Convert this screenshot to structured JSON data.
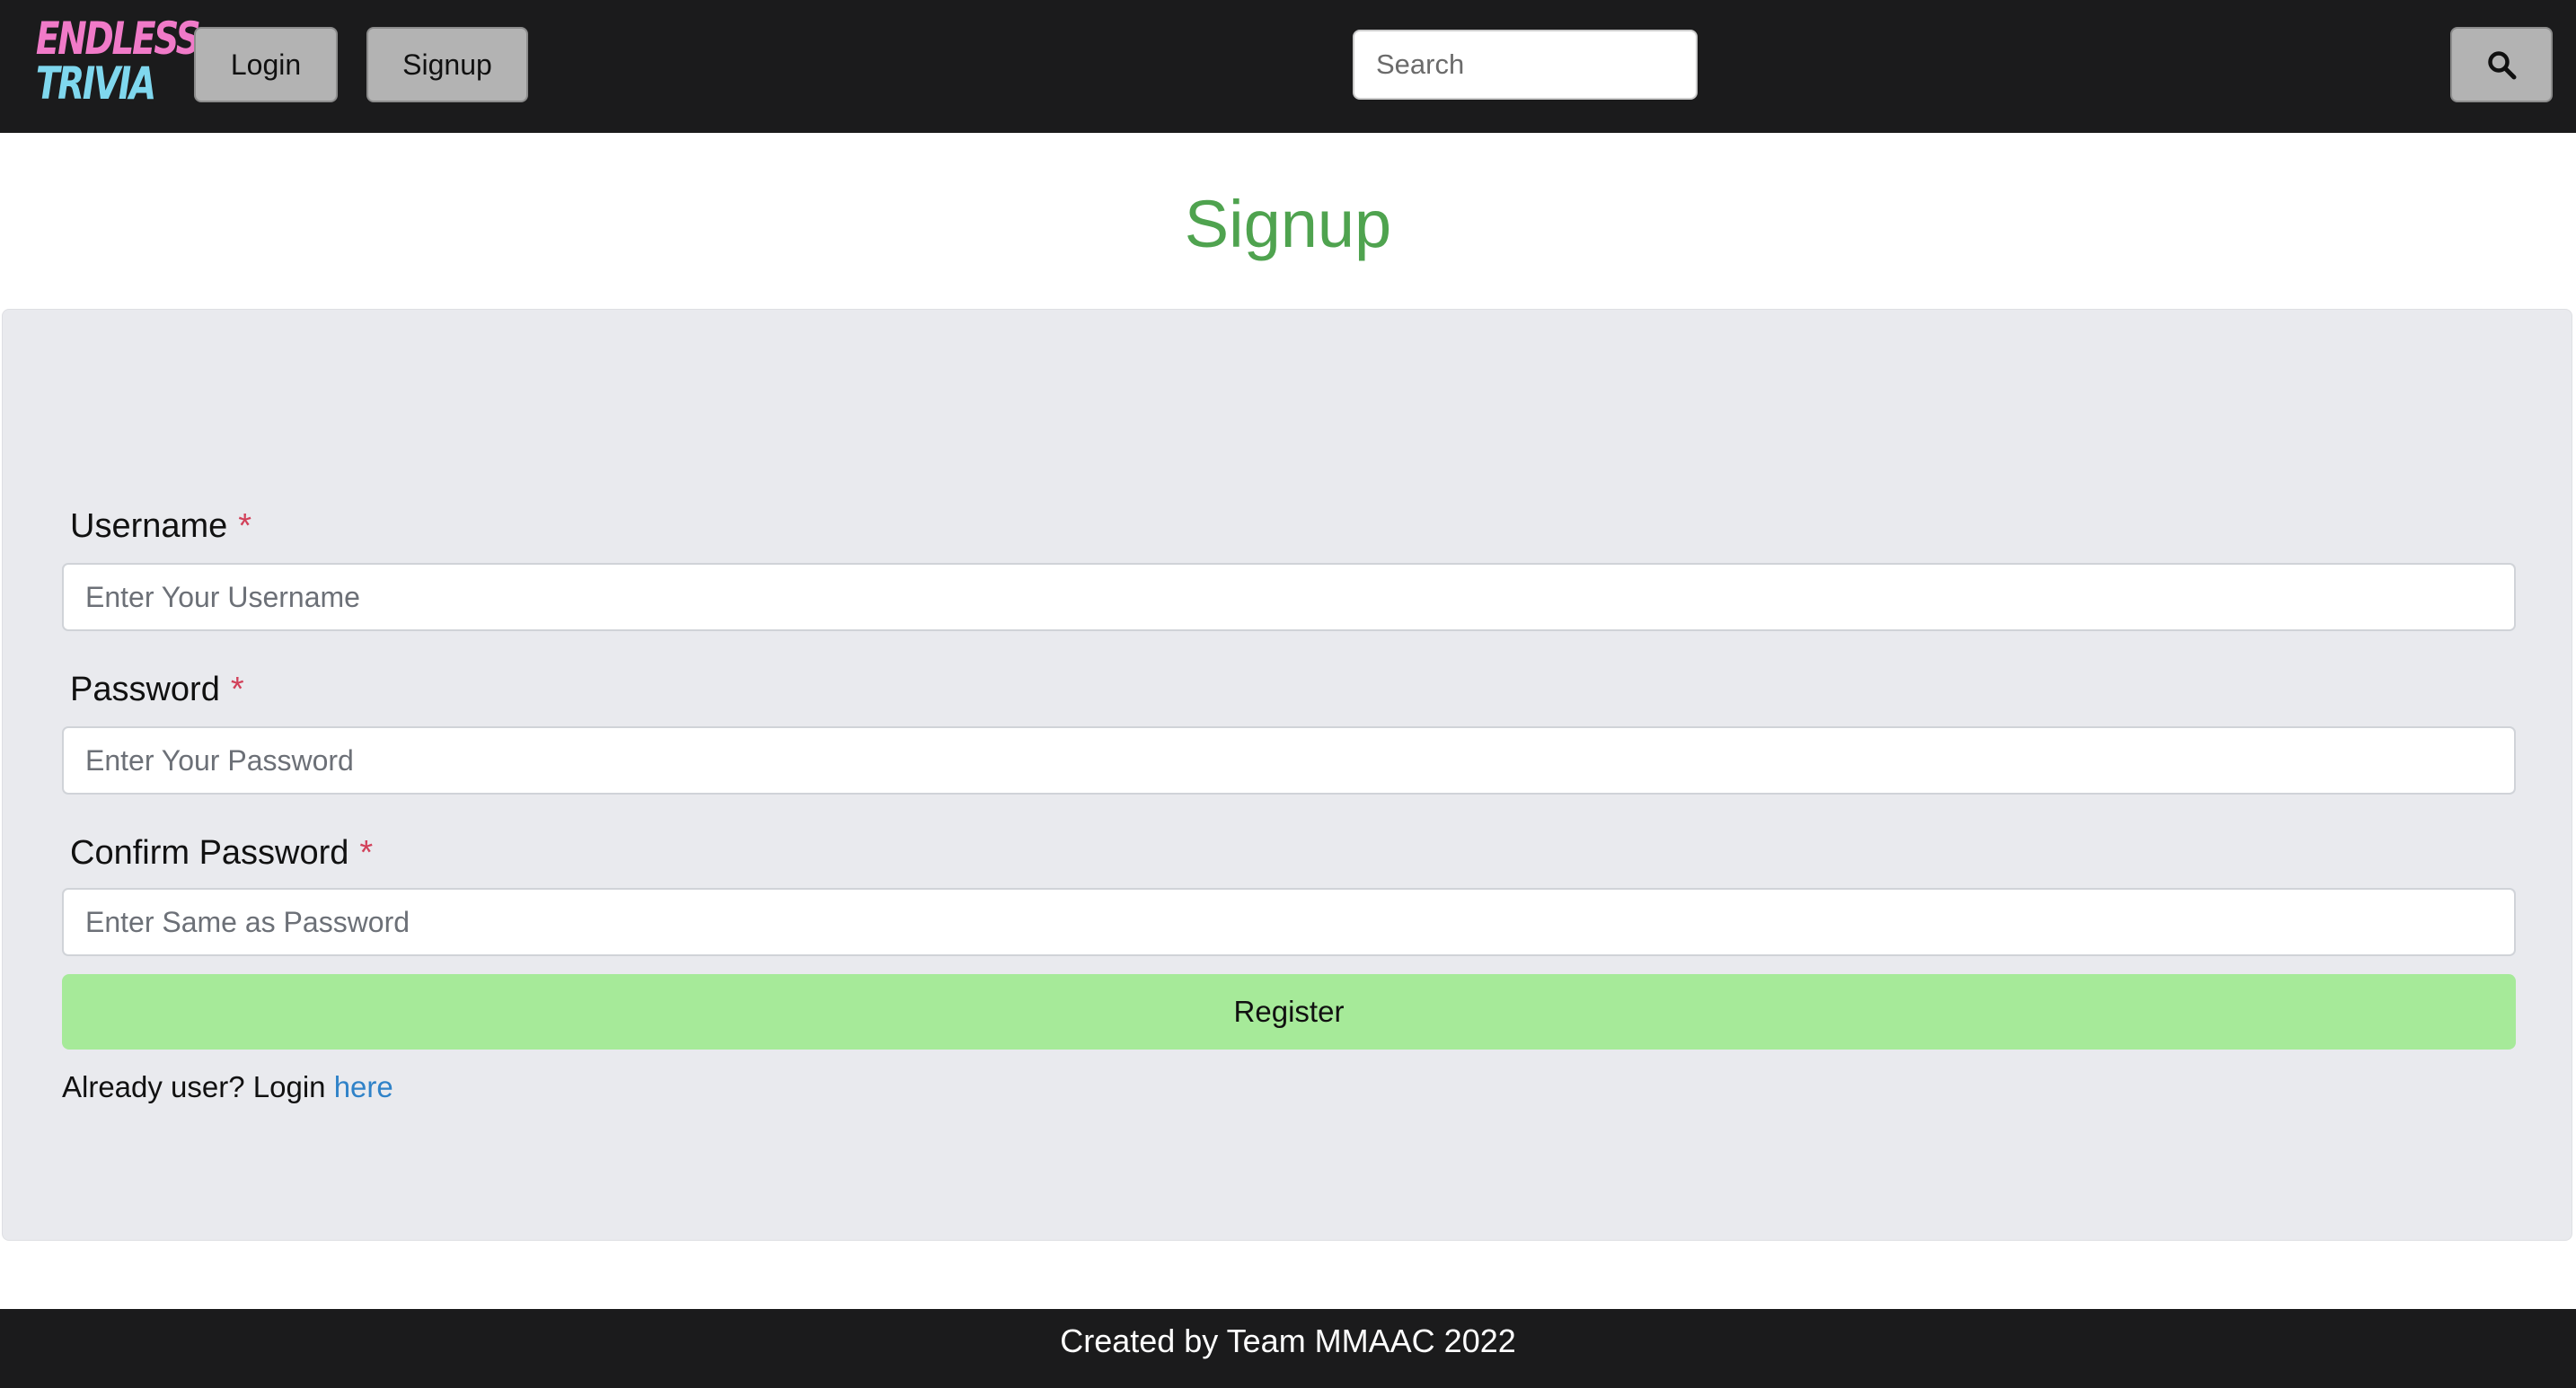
{
  "header": {
    "logo": {
      "line1": "ENDLESS",
      "line2": "TRIVIA",
      "line1_color": "#f07ac8",
      "line2_color": "#7fd7ee"
    },
    "nav": {
      "login_label": "Login",
      "signup_label": "Signup"
    },
    "search": {
      "placeholder": "Search",
      "button_icon": "search-icon"
    }
  },
  "main": {
    "title": "Signup",
    "title_color": "#4fa34f",
    "form": {
      "username": {
        "label": "Username",
        "required_marker": "*",
        "placeholder": "Enter Your Username"
      },
      "password": {
        "label": "Password",
        "required_marker": "*",
        "placeholder": "Enter Your Password"
      },
      "confirm_password": {
        "label": "Confirm Password",
        "required_marker": "*",
        "placeholder": "Enter Same as Password"
      },
      "register_label": "Register",
      "register_color": "#a6ea99",
      "login_prompt": "Already user? Login",
      "login_link": "here"
    }
  },
  "footer": {
    "text": "Created by Team MMAAC 2022"
  }
}
